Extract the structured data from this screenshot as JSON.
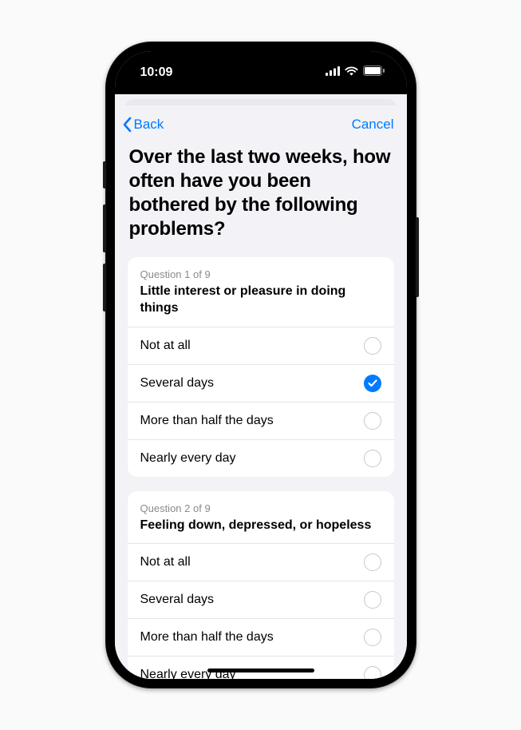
{
  "status": {
    "time": "10:09"
  },
  "nav": {
    "back": "Back",
    "cancel": "Cancel"
  },
  "title": "Over the last two weeks, how often have you been bothered by the following problems?",
  "questions": [
    {
      "counter": "Question 1 of 9",
      "text": "Little interest or pleasure in doing things",
      "options": [
        {
          "label": "Not at all",
          "selected": false
        },
        {
          "label": "Several days",
          "selected": true
        },
        {
          "label": "More than half the days",
          "selected": false
        },
        {
          "label": "Nearly every day",
          "selected": false
        }
      ]
    },
    {
      "counter": "Question 2 of 9",
      "text": "Feeling down, depressed, or hopeless",
      "options": [
        {
          "label": "Not at all",
          "selected": false
        },
        {
          "label": "Several days",
          "selected": false
        },
        {
          "label": "More than half the days",
          "selected": false
        },
        {
          "label": "Nearly every day",
          "selected": false
        }
      ]
    }
  ],
  "colors": {
    "accent": "#007aff"
  }
}
